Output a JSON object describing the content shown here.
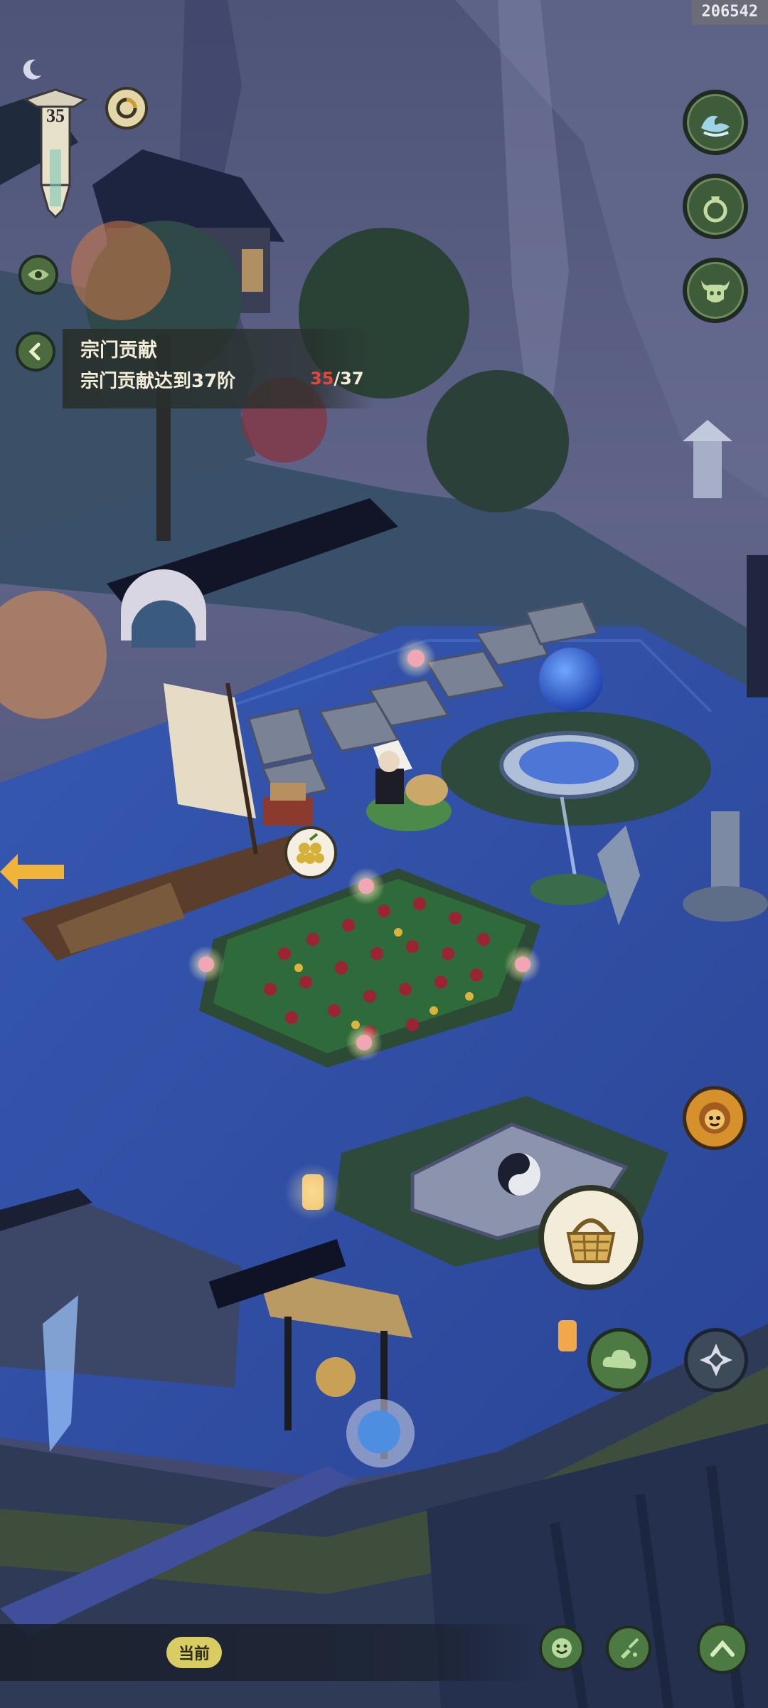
{
  "build_id": "206542",
  "level": "35",
  "quest": {
    "title": "宗门贡献",
    "description": "宗门贡献达到37阶",
    "progress_current": "35",
    "progress_total": "/37"
  },
  "bottom_bar": {
    "current_label": "当前"
  },
  "icons": {
    "top_right": [
      "wave-icon",
      "gourd-icon",
      "ox-icon"
    ],
    "right_lower": [
      "lion-mask-icon",
      "basket-icon",
      "cloud-icon",
      "compass-icon"
    ],
    "bottom": [
      "smile-icon",
      "brush-icon",
      "chevron-up-icon"
    ],
    "top_left": [
      "moon-icon",
      "ring-icon",
      "eye-icon",
      "back-arrow-icon"
    ]
  },
  "colors": {
    "water": "#3d5fb8",
    "sky": "#585e86",
    "button_green": "#3f5c3a",
    "progress_current": "#e0473b",
    "quest_text": "#f2ecd9"
  }
}
